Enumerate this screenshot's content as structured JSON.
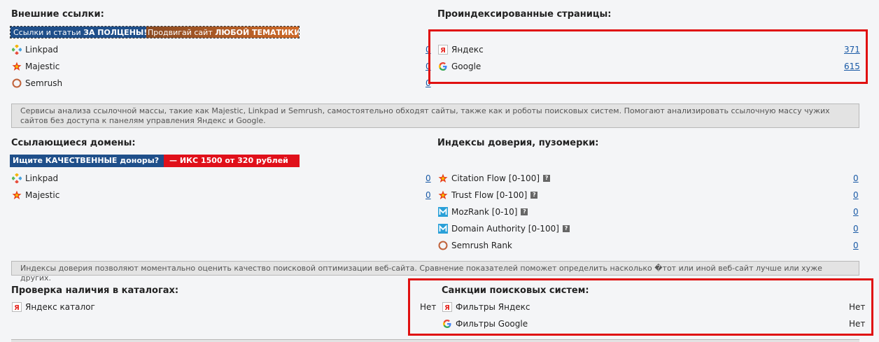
{
  "external_links": {
    "title": "Внешние ссылки:",
    "banner": {
      "p1": "Ссылки и статьи ",
      "p2": "ЗА ПОЛЦЕНЫ!",
      "p3": " Продвигай сайт ",
      "p4": "ЛЮБОЙ ТЕМАТИКИ!"
    },
    "items": [
      {
        "label": "Linkpad",
        "value": "0"
      },
      {
        "label": "Majestic",
        "value": "0"
      },
      {
        "label": "Semrush",
        "value": "0"
      }
    ]
  },
  "indexed_pages": {
    "title": "Проиндексированные страницы:",
    "items": [
      {
        "label": "Яндекс",
        "value": "371"
      },
      {
        "label": "Google",
        "value": "615"
      }
    ]
  },
  "info1": "Сервисы анализа ссылочной массы, такие как Majestic, Linkpad и Semrush, самостоятельно обходят сайты, также как и роботы поисковых систем. Помогают анализировать ссылочную массу чужих сайтов без доступа к панелям управления Яндекс и Google.",
  "referring_domains": {
    "title": "Ссылающиеся домены:",
    "banner": {
      "left": "Ищите КАЧЕСТВЕННЫЕ доноры?",
      "right": "— ИКС 1500 от 320 рублей"
    },
    "items": [
      {
        "label": "Linkpad",
        "value": "0"
      },
      {
        "label": "Majestic",
        "value": "0"
      }
    ]
  },
  "trust": {
    "title": "Индексы доверия, пузомерки:",
    "items": [
      {
        "label": "Citation Flow [0-100]",
        "value": "0",
        "help": "?"
      },
      {
        "label": "Trust Flow [0-100]",
        "value": "0",
        "help": "?"
      },
      {
        "label": "MozRank [0-10]",
        "value": "0",
        "help": "?"
      },
      {
        "label": "Domain Authority [0-100]",
        "value": "0",
        "help": "?"
      },
      {
        "label": "Semrush Rank",
        "value": "0"
      }
    ]
  },
  "info2": "Индексы доверия позволяют моментально оценить качество поисковой оптимизации веб-сайта. Сравнение показателей поможет определить насколько �тот или иной веб-сайт лучше или хуже других.",
  "catalogs": {
    "title": "Проверка наличия в каталогах:",
    "items": [
      {
        "label": "Яндекс каталог",
        "value": "Нет"
      }
    ]
  },
  "sanctions": {
    "title": "Санкции поисковых систем:",
    "items": [
      {
        "label": "Фильтры Яндекс",
        "value": "Нет"
      },
      {
        "label": "Фильтры Google",
        "value": "Нет"
      }
    ]
  },
  "colors": {
    "link": "#1a5aa6",
    "highlight": "#e01010",
    "banner_blue": "#1f4f8a",
    "banner_orange": "#c8662a",
    "banner_red": "#e0101a"
  },
  "icons": [
    "linkpad-icon",
    "majestic-star-icon",
    "semrush-icon",
    "yandex-icon",
    "google-icon",
    "moz-icon",
    "help-icon"
  ]
}
